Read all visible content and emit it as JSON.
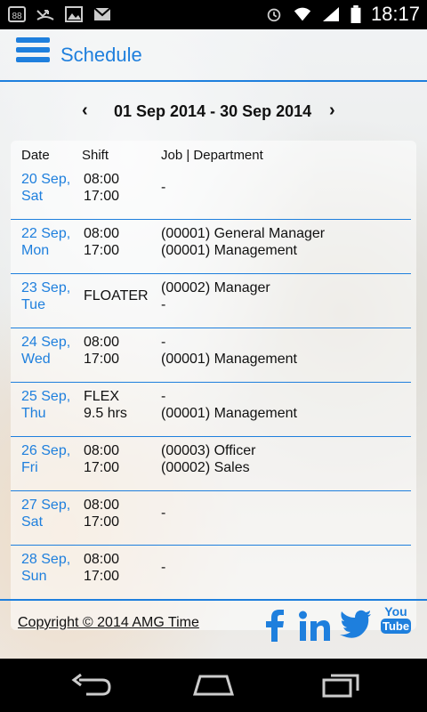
{
  "status_bar": {
    "time": "18:17",
    "left_icons": [
      "notification-88-icon",
      "missed-call-icon",
      "image-icon",
      "gmail-icon"
    ],
    "right_icons": [
      "alarm-icon",
      "wifi-icon",
      "signal-icon",
      "battery-icon"
    ]
  },
  "header": {
    "title": "Schedule"
  },
  "range": {
    "prev": "‹",
    "label": "01 Sep 2014 - 30 Sep 2014",
    "next": "›"
  },
  "table": {
    "columns": [
      "Date",
      "Shift",
      "Job | Department"
    ],
    "rows": [
      {
        "date1": "20 Sep,",
        "date2": "Sat",
        "shift1": "08:00",
        "shift2": "17:00",
        "job1": "-",
        "job2": ""
      },
      {
        "date1": "22 Sep,",
        "date2": "Mon",
        "shift1": "08:00",
        "shift2": "17:00",
        "job1": "(00001) General Manager",
        "job2": "(00001) Management"
      },
      {
        "date1": "23 Sep,",
        "date2": "Tue",
        "shift1": "FLOATER",
        "shift2": "",
        "job1": "(00002) Manager",
        "job2": "-"
      },
      {
        "date1": "24 Sep,",
        "date2": "Wed",
        "shift1": "08:00",
        "shift2": "17:00",
        "job1": "-",
        "job2": "(00001) Management"
      },
      {
        "date1": "25 Sep,",
        "date2": "Thu",
        "shift1": "FLEX",
        "shift2": "9.5 hrs",
        "job1": "-",
        "job2": "(00001) Management"
      },
      {
        "date1": "26 Sep,",
        "date2": "Fri",
        "shift1": "08:00",
        "shift2": "17:00",
        "job1": "(00003) Officer",
        "job2": "(00002) Sales"
      },
      {
        "date1": "27 Sep,",
        "date2": "Sat",
        "shift1": "08:00",
        "shift2": "17:00",
        "job1": "-",
        "job2": ""
      },
      {
        "date1": "28 Sep,",
        "date2": "Sun",
        "shift1": "08:00",
        "shift2": "17:00",
        "job1": "-",
        "job2": ""
      }
    ]
  },
  "footer": {
    "copyright": "Copyright © 2014 AMG Time",
    "social": [
      "facebook-icon",
      "linkedin-icon",
      "twitter-icon",
      "youtube-icon"
    ],
    "youtube_text_top": "You",
    "youtube_text_bottom": "Tube"
  },
  "colors": {
    "accent": "#1e7fdd"
  },
  "nav_bar": {
    "buttons": [
      "back-icon",
      "home-icon",
      "recents-icon"
    ]
  }
}
